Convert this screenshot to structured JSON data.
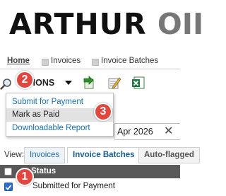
{
  "header": {
    "logo_text": "ARTHUR",
    "logo_tail": "OII"
  },
  "breadcrumb": {
    "home": "Home",
    "invoices": "Invoices",
    "invoice_batches": "Invoice Batches"
  },
  "toolbar": {
    "actions_label": "CTIONS",
    "icons": [
      "search-icon",
      "export-arrow-icon",
      "edit-pencil-icon",
      "excel-icon"
    ]
  },
  "actions_menu": {
    "items": [
      {
        "label": "Submit for Payment",
        "active": false
      },
      {
        "label": "Mark as Paid",
        "active": true
      },
      {
        "label": "Downloadable Report",
        "active": false
      }
    ]
  },
  "date_filter": {
    "value": "Apr 2026",
    "clear_glyph": "✕"
  },
  "view": {
    "label": "View:",
    "tabs": [
      {
        "label": "Invoices",
        "selected": false
      },
      {
        "label": "Invoice Batches",
        "selected": true
      },
      {
        "label": "Auto-flagged",
        "selected": false
      }
    ]
  },
  "table": {
    "columns": [
      "Status"
    ],
    "rows": [
      {
        "status": "Submitted for Payment",
        "checked": true
      }
    ]
  },
  "annotations": {
    "steps": [
      "1",
      "2",
      "3"
    ],
    "badge_color": "#e2473f"
  },
  "colors": {
    "link": "#1c6fa8",
    "header_bg": "#595959",
    "checkbox": "#2a6fc9"
  }
}
